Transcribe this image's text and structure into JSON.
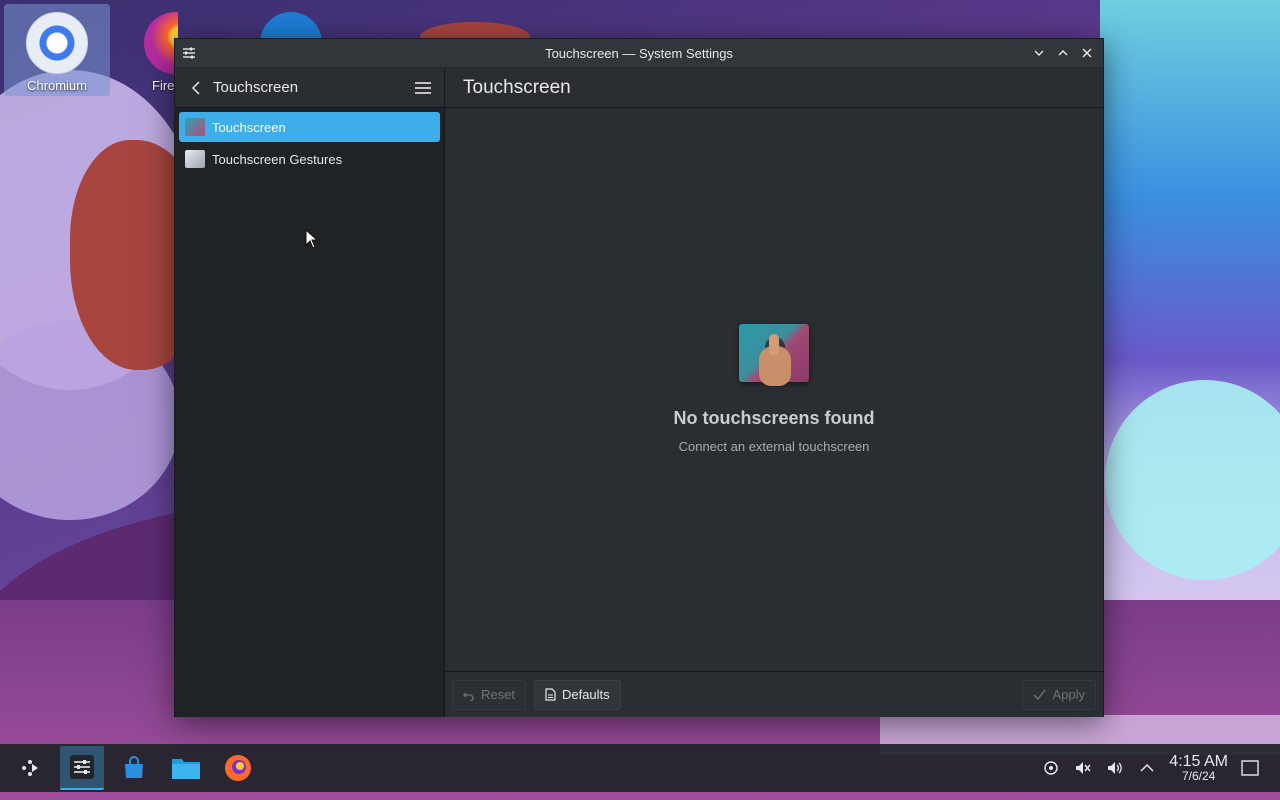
{
  "window": {
    "title": "Touchscreen — System Settings"
  },
  "sidebar": {
    "title": "Touchscreen",
    "items": [
      {
        "label": "Touchscreen",
        "active": true
      },
      {
        "label": "Touchscreen Gestures",
        "active": false
      }
    ]
  },
  "main": {
    "title": "Touchscreen",
    "placeholder": {
      "heading": "No touchscreens found",
      "subtext": "Connect an external touchscreen"
    }
  },
  "footer": {
    "reset_label": "Reset",
    "defaults_label": "Defaults",
    "apply_label": "Apply"
  },
  "desktop": {
    "icons": [
      {
        "label": "Chromium"
      },
      {
        "label": "Fire"
      }
    ]
  },
  "taskbar": {
    "clock_time": "4:15 AM",
    "clock_date": "7/6/24"
  },
  "colors": {
    "accent": "#3daee9",
    "window_bg": "#2a2e32",
    "sidebar_bg": "#202326"
  }
}
